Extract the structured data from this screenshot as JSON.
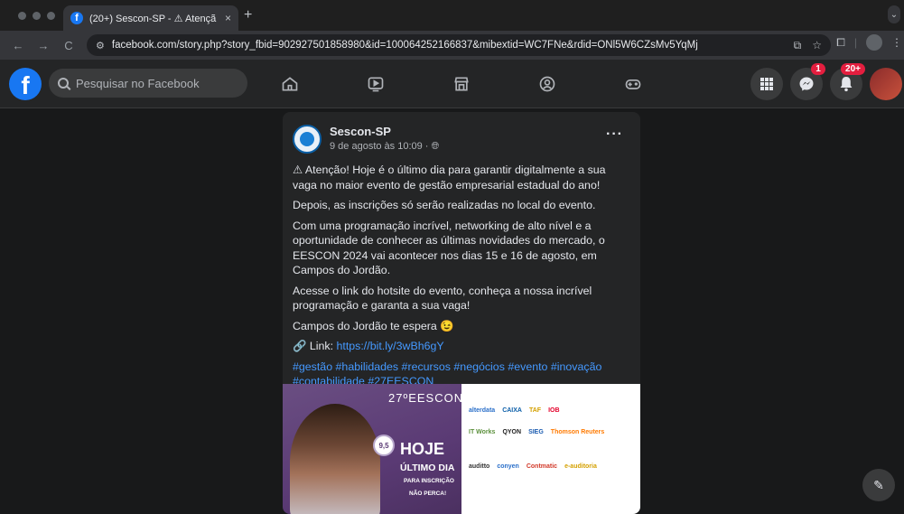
{
  "browser": {
    "tab_title": "(20+) Sescon-SP - ⚠ Atençã",
    "tab_close": "×",
    "new_tab": "+",
    "url": "facebook.com/story.php?story_fbid=902927501858980&id=100064252166837&mibextid=WC7FNe&rdid=ONl5W6CZsMv5YqMj",
    "back": "←",
    "forward": "→",
    "reload": "C"
  },
  "fbnav": {
    "logo": "f",
    "search_placeholder": "Pesquisar no Facebook",
    "messenger_badge": "1",
    "notifications_badge": "20+"
  },
  "post": {
    "page_name": "Sescon-SP",
    "date": "9 de agosto às 10:09 · ",
    "more": "···",
    "paragraphs": [
      "⚠ Atenção! Hoje é o último dia para garantir digitalmente a sua vaga no maior evento de gestão empresarial estadual do ano!",
      "Depois, as inscrições só serão realizadas no local do evento.",
      "Com uma programação incrível, networking de alto nível e a oportunidade de conhecer as últimas novidades do mercado, o EESCON 2024 vai acontecer nos dias 15 e 16 de agosto, em Campos do Jordão.",
      "Acesse o link do hotsite do evento, conheça a nossa incrível programação e garanta a sua vaga!",
      "Campos do Jordão te espera 😉"
    ],
    "link_prefix": "🔗 Link: ",
    "link_url": "https://bit.ly/3wBh6gY",
    "hashtags": "#gestão #habilidades #recursos #negócios #evento #inovação #contabilidade #27EESCON"
  },
  "banner": {
    "brand": "27ºEESCON",
    "seal": "9,5",
    "hoje": "HOJE",
    "ultimo": "ÚLTIMO DIA",
    "para": "PARA INSCRIÇÃO",
    "nao_perca": "NÃO PERCA!",
    "sponsors_row1": [
      "alterdata",
      "CAIXA",
      "TAF",
      "IOB"
    ],
    "sponsors_row2": [
      "IT Works",
      "QYON",
      "SIEG",
      "Thomson Reuters"
    ],
    "sponsors_row3": [
      "auditto",
      "conyen",
      "Contmatic",
      "e-auditoria"
    ]
  },
  "colors": {
    "fb_blue": "#1877f2",
    "badge_red": "#e41e3f",
    "link_blue": "#4599ff"
  }
}
